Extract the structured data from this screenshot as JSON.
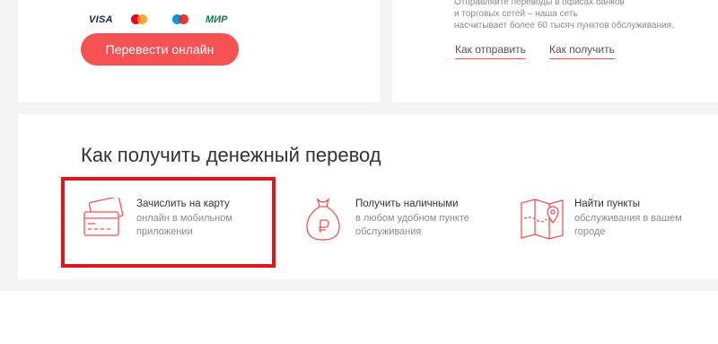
{
  "payment": {
    "visa": "VISA",
    "mir": "МИР",
    "transfer_button": "Перевести онлайн"
  },
  "info": {
    "line1": "Отправляйте переводы в офисах банков",
    "line2": "и торговых сетей – наша сеть",
    "line3": "насчитывает более 60 тысяч пунктов обслуживания.",
    "link_send": "Как отправить",
    "link_receive": "Как получить"
  },
  "receive": {
    "title": "Как получить денежный перевод",
    "options": [
      {
        "title": "Зачислить на карту",
        "desc": "онлайн в мобильном приложении",
        "icon": "card-icon"
      },
      {
        "title": "Получить наличными",
        "desc": "в любом удобном пункте обслуживания",
        "icon": "money-bag-icon"
      },
      {
        "title": "Найти пункты",
        "desc": "обслуживания в вашем городе",
        "icon": "map-pin-icon"
      }
    ]
  },
  "colors": {
    "accent": "#f45253",
    "highlight": "#e3151c",
    "text_dark": "#333333",
    "text_muted": "#8a8a8a"
  }
}
